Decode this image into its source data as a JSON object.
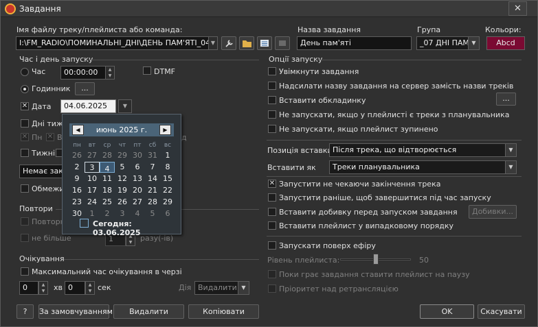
{
  "window": {
    "title": "Завдання",
    "close": "✕"
  },
  "top": {
    "file_label": "Імя файлу треку/плейлиста або команда:",
    "file_value": "I:\\FM_RADIO\\ПОМИНАЛЬНІ_ДНІ\\ДЕНЬ ПАМ'ЯТІ_04_0",
    "name_label": "Назва завдання",
    "name_value": "День пам'яті",
    "group_label": "Група",
    "group_value": "_07 ДНІ ПАМ'Я",
    "colors_label": "Кольори:",
    "colors_value": "Abcd",
    "colors_bg": "#7a0a32"
  },
  "launch": {
    "section": "Час і день запуску",
    "time_label": "Час",
    "time_value": "00:00:00",
    "dtmf_label": "DTMF",
    "clock_label": "Годинник",
    "clock_btn": "...",
    "date_label": "Дата",
    "date_value": "04.06.2025",
    "weekdays_label": "Дні тиж",
    "mon_label": "Пн",
    "tue_label": "В",
    "sun_label": "д",
    "weeks_label": "Тижні",
    "none_value": "Немає закі",
    "limit_label": "Обмежи"
  },
  "repeats": {
    "section": "Повтори",
    "repeat_label": "Повторн",
    "no_more_label": "не більше",
    "count_value": "1",
    "times_label": "разу(-ів)"
  },
  "waiting": {
    "section": "Очікування",
    "max_label": "Максимальний час очікування в черзі",
    "min_value": "0",
    "min_unit": "хв",
    "sec_value": "0",
    "sec_unit": "сек",
    "action_label": "Дія",
    "action_value": "Видалити"
  },
  "options": {
    "section": "Опції запуску",
    "items": [
      "Увімкнути завдання",
      "Надсилати назву завдання на сервер замість назви треків",
      "Вставити обкладинку",
      "Не запускати, якщо у плейлисті є треки з планувальника",
      "Не запускати, якщо плейлист зупинено"
    ],
    "cover_btn": "...",
    "position_label": "Позиція вставки",
    "position_value": "Після трека, що відтворюється",
    "insert_as_label": "Вставити як",
    "insert_as_value": "Треки планувальника",
    "run_items": [
      "Запустити не чекаючи закінчення трека",
      "Запустити раніше, щоб завершитися під час запуску",
      "Вставити добивку перед запуском завдання",
      "Вставити плейлист у випадковому порядку"
    ],
    "fillers_btn": "Добивки...",
    "on_air_label": "Запускати поверх ефіру",
    "level_label": "Рівень плейлиста:",
    "level_value": "50",
    "level_fraction": 0.5,
    "pause_label": "Поки грає завдання ставити плейлист на паузу",
    "priority_label": "Пріоритет над ретрансляцією"
  },
  "calendar": {
    "month": "июнь 2025 г.",
    "prev": "◀",
    "next": "▶",
    "dow": [
      "пн",
      "вт",
      "ср",
      "чт",
      "пт",
      "сб",
      "вс"
    ],
    "weeks": [
      [
        "26",
        "27",
        "28",
        "29",
        "30",
        "31",
        "1"
      ],
      [
        "2",
        "3",
        "4",
        "5",
        "6",
        "7",
        "8"
      ],
      [
        "9",
        "10",
        "11",
        "12",
        "13",
        "14",
        "15"
      ],
      [
        "16",
        "17",
        "18",
        "19",
        "20",
        "21",
        "22"
      ],
      [
        "23",
        "24",
        "25",
        "26",
        "27",
        "28",
        "29"
      ],
      [
        "30",
        "1",
        "2",
        "3",
        "4",
        "5",
        "6"
      ]
    ],
    "today_label": "Сегодня: 03.06.2025"
  },
  "bottom": {
    "help": "?",
    "by_default": "За замовчуванням",
    "delete": "Видалити",
    "copy": "Копіювати",
    "ok": "OK",
    "cancel": "Скасувати"
  }
}
